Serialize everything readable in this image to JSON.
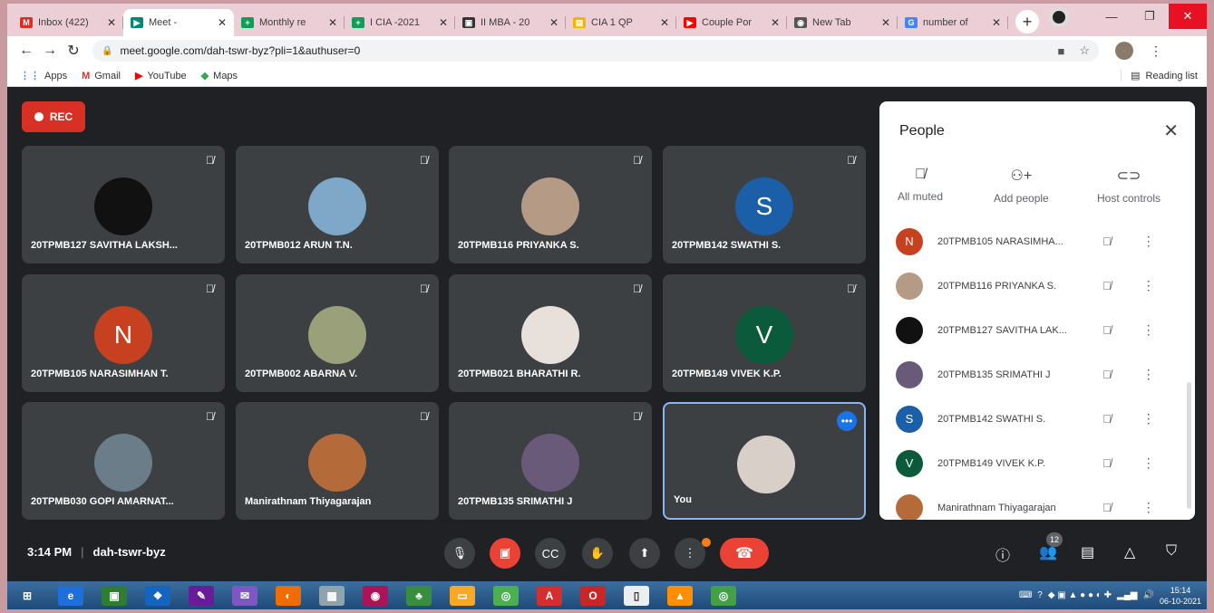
{
  "tabs": [
    {
      "title": "Inbox (422)",
      "fav": "M",
      "color": "#d93025"
    },
    {
      "title": "Meet -",
      "fav": "▶",
      "color": "#00897b",
      "active": true
    },
    {
      "title": "Monthly re",
      "fav": "+",
      "color": "#0f9d58"
    },
    {
      "title": "I CIA -2021",
      "fav": "+",
      "color": "#0f9d58"
    },
    {
      "title": "II MBA - 20",
      "fav": "▣",
      "color": "#333333"
    },
    {
      "title": "CIA 1 QP",
      "fav": "▤",
      "color": "#f4b400"
    },
    {
      "title": "Couple Por",
      "fav": "▶",
      "color": "#ff0000"
    },
    {
      "title": "New Tab",
      "fav": "◉",
      "color": "#555555"
    },
    {
      "title": "number of",
      "fav": "G",
      "color": "#4285f4"
    }
  ],
  "address": {
    "url": "meet.google.com/dah-tswr-byz?pli=1&authuser=0"
  },
  "bookmarks": [
    {
      "label": "Apps",
      "icon": "apps-icon"
    },
    {
      "label": "Gmail",
      "icon": "gmail-icon"
    },
    {
      "label": "YouTube",
      "icon": "youtube-icon"
    },
    {
      "label": "Maps",
      "icon": "maps-icon"
    }
  ],
  "reading_list": "Reading list",
  "rec_label": "REC",
  "tiles": [
    {
      "name": "20TPMB127 SAVITHA LAKSH...",
      "initial": "",
      "color": "#111111"
    },
    {
      "name": "20TPMB012 ARUN T.N.",
      "initial": "",
      "color": "#7fa8c8"
    },
    {
      "name": "20TPMB116 PRIYANKA S.",
      "initial": "",
      "color": "#b59a86"
    },
    {
      "name": "20TPMB142 SWATHI S.",
      "initial": "S",
      "color": "#1a5fa8"
    },
    {
      "name": "20TPMB105 NARASIMHAN T.",
      "initial": "N",
      "color": "#c7401f"
    },
    {
      "name": "20TPMB002 ABARNA V.",
      "initial": "",
      "color": "#9aa07a"
    },
    {
      "name": "20TPMB021 BHARATHI R.",
      "initial": "",
      "color": "#e8e0da"
    },
    {
      "name": "20TPMB149 VIVEK K.P.",
      "initial": "V",
      "color": "#0b5a3c"
    },
    {
      "name": "20TPMB030 GOPI AMARNAT...",
      "initial": "",
      "color": "#6c7d8a"
    },
    {
      "name": "Manirathnam Thiyagarajan",
      "initial": "",
      "color": "#b56a3a"
    },
    {
      "name": "20TPMB135 SRIMATHI J",
      "initial": "",
      "color": "#6a5a7a"
    },
    {
      "name": "You",
      "initial": "",
      "color": "#d8cfc8"
    }
  ],
  "people": {
    "title": "People",
    "actions": [
      {
        "label": "All muted",
        "icon": "mic-off-icon"
      },
      {
        "label": "Add people",
        "icon": "add-person-icon"
      },
      {
        "label": "Host controls",
        "icon": "toggle-icon"
      }
    ],
    "list": [
      {
        "name": "20TPMB105 NARASIMHA...",
        "initial": "N",
        "color": "#c7401f"
      },
      {
        "name": "20TPMB116 PRIYANKA S.",
        "initial": "",
        "color": "#b59a86"
      },
      {
        "name": "20TPMB127 SAVITHA LAK...",
        "initial": "",
        "color": "#111111"
      },
      {
        "name": "20TPMB135 SRIMATHI J",
        "initial": "",
        "color": "#6a5a7a"
      },
      {
        "name": "20TPMB142 SWATHI S.",
        "initial": "S",
        "color": "#1a5fa8"
      },
      {
        "name": "20TPMB149 VIVEK K.P.",
        "initial": "V",
        "color": "#0b5a3c"
      },
      {
        "name": "Manirathnam Thiyagarajan",
        "initial": "",
        "color": "#b56a3a"
      }
    ]
  },
  "meeting": {
    "time": "3:14 PM",
    "code": "dah-tswr-byz",
    "participants_badge": "12"
  },
  "taskbar": {
    "time": "15:14",
    "date": "06-10-2021"
  }
}
